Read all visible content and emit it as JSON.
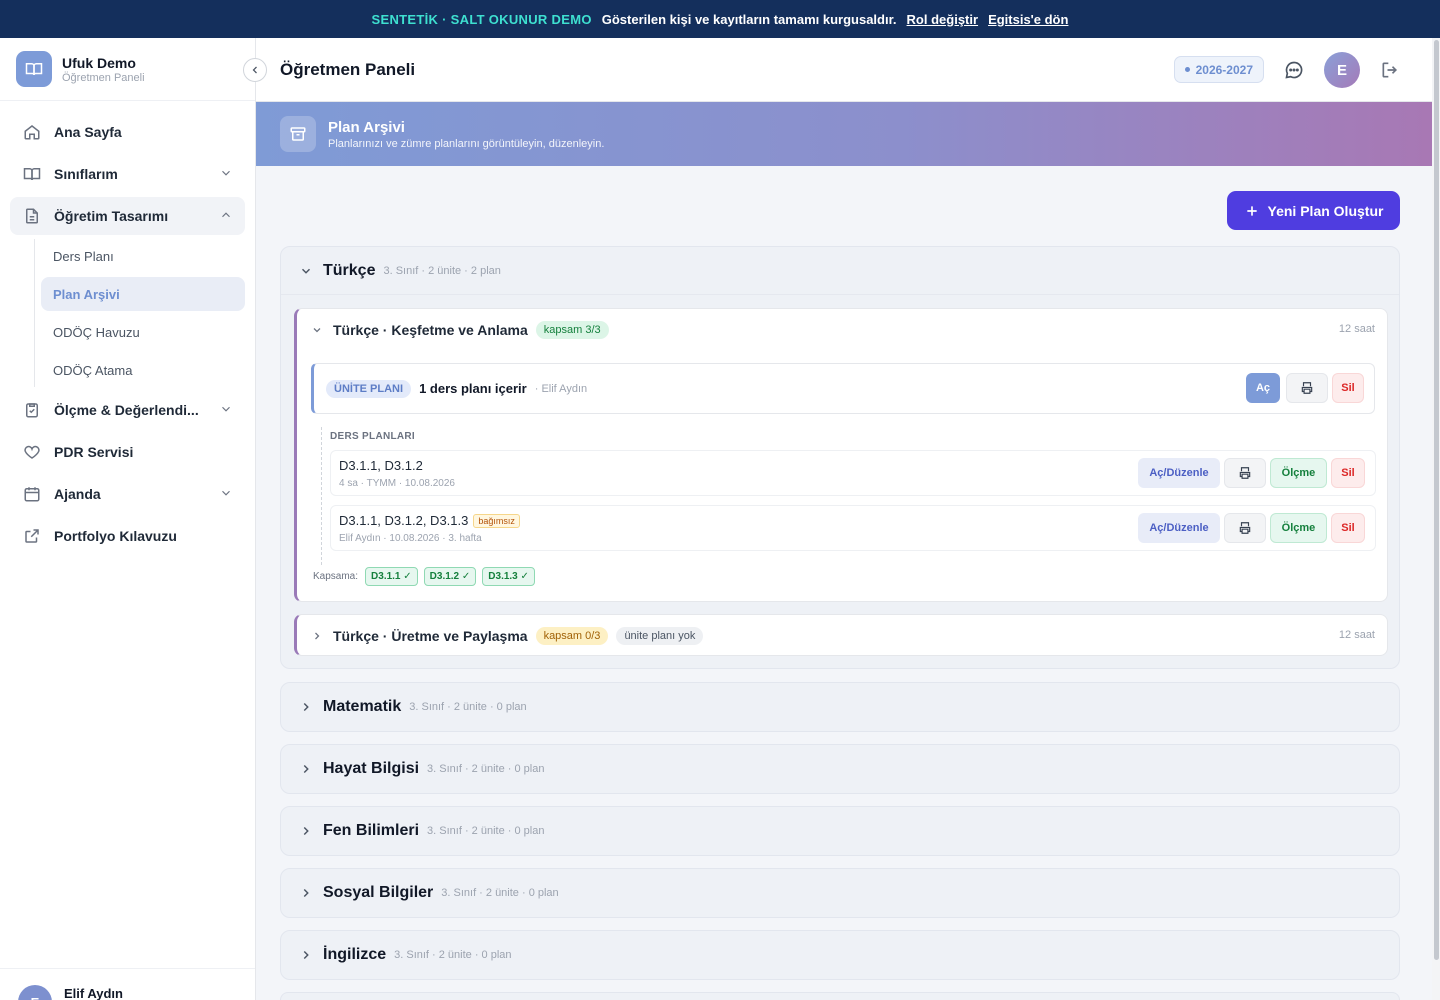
{
  "banner": {
    "tag": "SENTETİK · SALT OKUNUR DEMO",
    "message": "Gösterilen kişi ve kayıtların tamamı kurgusaldır.",
    "link_role": "Rol değiştir",
    "link_back": "Egitsis'e dön"
  },
  "brand": {
    "title": "Ufuk Demo",
    "subtitle": "Öğretmen Paneli"
  },
  "sidebar": {
    "items": [
      {
        "label": "Ana Sayfa",
        "icon": "home-icon"
      },
      {
        "label": "Sınıflarım",
        "icon": "book-icon"
      },
      {
        "label": "Öğretim Tasarımı",
        "icon": "document-icon"
      },
      {
        "label": "Ölçme & Değerlendi...",
        "icon": "clipboard-icon"
      },
      {
        "label": "PDR Servisi",
        "icon": "heart-icon"
      },
      {
        "label": "Ajanda",
        "icon": "calendar-icon"
      },
      {
        "label": "Portfolyo Kılavuzu",
        "icon": "external-link-icon"
      }
    ],
    "subitems": [
      "Ders Planı",
      "Plan Arşivi",
      "ODÖÇ Havuzu",
      "ODÖÇ Atama"
    ]
  },
  "user": {
    "name": "Elif Aydın",
    "initial": "E"
  },
  "header": {
    "title": "Öğretmen Paneli",
    "year": "2026-2027",
    "avatar_initial": "E"
  },
  "hero": {
    "title": "Plan Arşivi",
    "subtitle": "Planlarınızı ve zümre planlarını görüntüleyin, düzenleyin."
  },
  "actions": {
    "new_plan": "Yeni Plan Oluştur"
  },
  "subjects": [
    {
      "name": "Türkçe",
      "meta": "3. Sınıf · 2 ünite · 2 plan",
      "units": [
        {
          "name": "Türkçe · Keşfetme ve Anlama",
          "coverage": "kapsam 3/3",
          "hours": "12 saat",
          "unit_plan": {
            "tag": "ÜNİTE PLANI",
            "title": "1 ders planı içerir",
            "author": "· Elif Aydın",
            "btn_open": "Aç",
            "btn_delete": "Sil"
          },
          "lessons_label": "DERS PLANLARI",
          "lessons": [
            {
              "title": "D3.1.1, D3.1.2",
              "meta": "4 sa · TYMM · 10.08.2026",
              "tag": "",
              "btn_edit": "Aç/Düzenle",
              "btn_measure": "Ölçme",
              "btn_delete": "Sil"
            },
            {
              "title": "D3.1.1, D3.1.2, D3.1.3",
              "meta": "Elif Aydın · 10.08.2026 · 3. hafta",
              "tag": "bağımsız",
              "btn_edit": "Aç/Düzenle",
              "btn_measure": "Ölçme",
              "btn_delete": "Sil"
            }
          ],
          "coverage_label": "Kapsama:",
          "coverage_chips": [
            "D3.1.1 ✓",
            "D3.1.2 ✓",
            "D3.1.3 ✓"
          ]
        },
        {
          "name": "Türkçe · Üretme ve Paylaşma",
          "coverage": "kapsam 0/3",
          "no_plan": "ünite planı yok",
          "hours": "12 saat"
        }
      ]
    },
    {
      "name": "Matematik",
      "meta": "3. Sınıf · 2 ünite · 0 plan"
    },
    {
      "name": "Hayat Bilgisi",
      "meta": "3. Sınıf · 2 ünite · 0 plan"
    },
    {
      "name": "Fen Bilimleri",
      "meta": "3. Sınıf · 2 ünite · 0 plan"
    },
    {
      "name": "Sosyal Bilgiler",
      "meta": "3. Sınıf · 2 ünite · 0 plan"
    },
    {
      "name": "İngilizce",
      "meta": "3. Sınıf · 2 ünite · 0 plan"
    }
  ],
  "colors": {
    "banner_bg": "#142f5c",
    "banner_tag": "#3ee0d0",
    "accent": "#4f3de0",
    "unit_accent": "#9a7ab8",
    "plan_accent": "#7d9bd8"
  }
}
